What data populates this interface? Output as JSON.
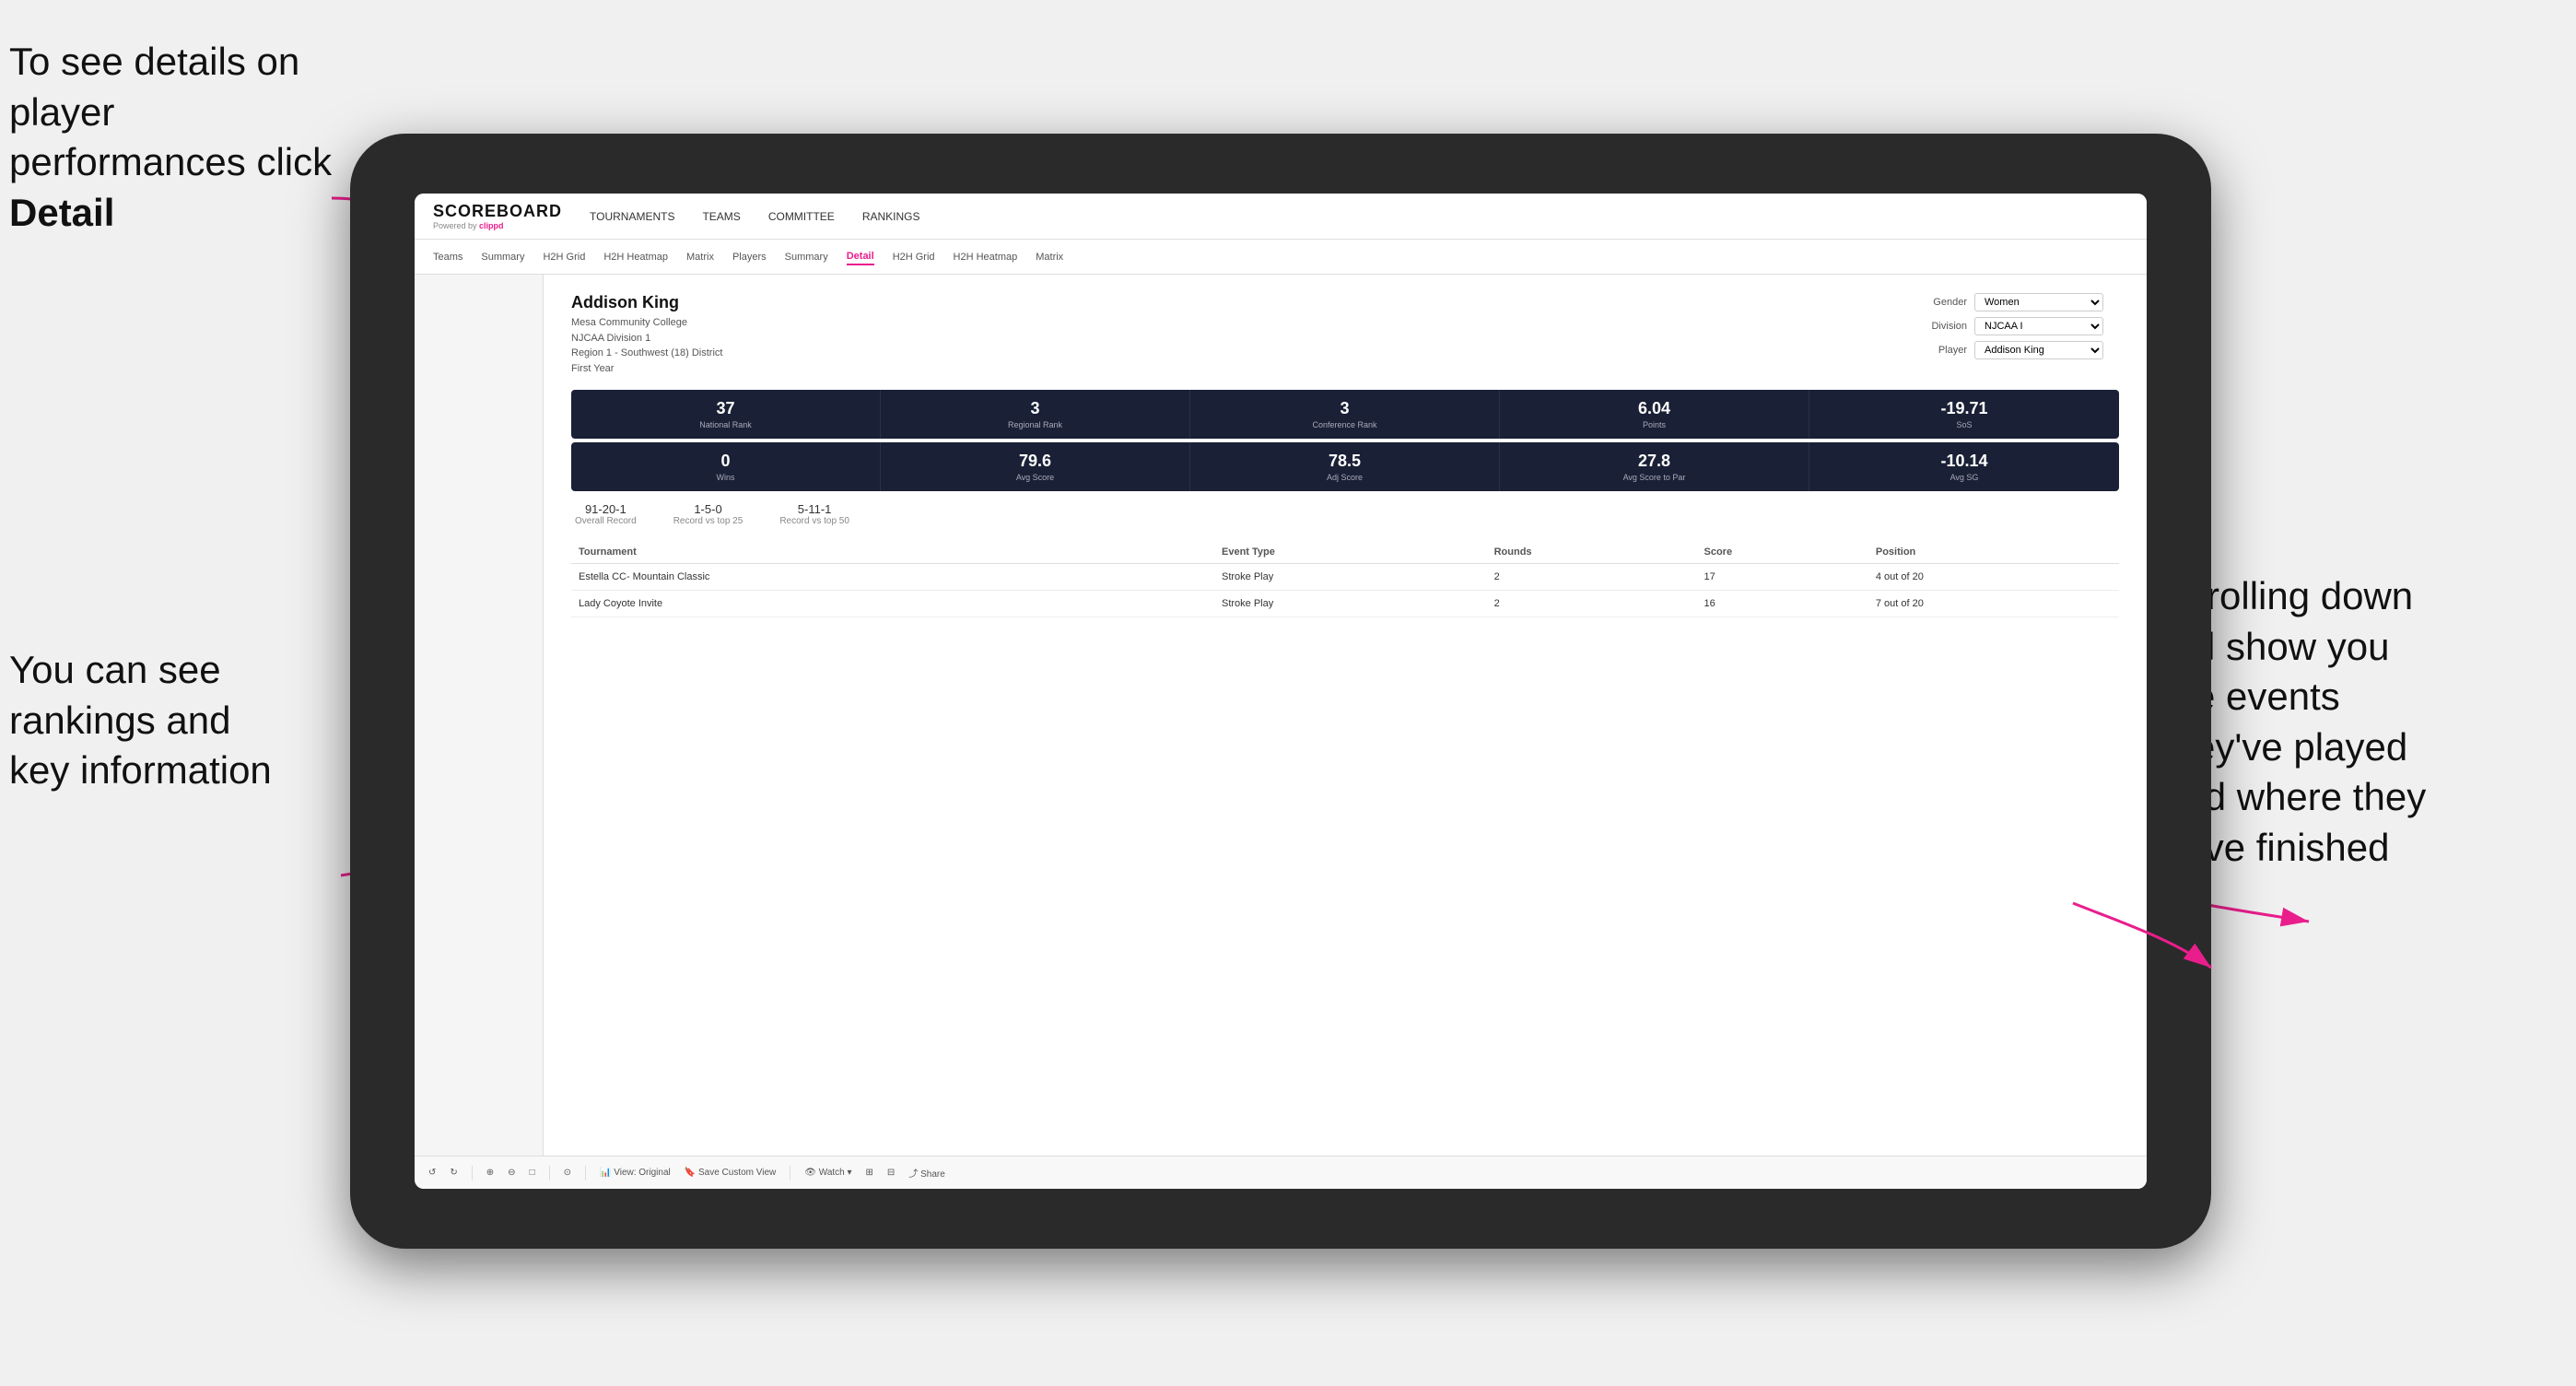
{
  "annotations": {
    "top_left": "To see details on player performances click ",
    "top_left_bold": "Detail",
    "bottom_left_line1": "You can see",
    "bottom_left_line2": "rankings and",
    "bottom_left_line3": "key information",
    "right_line1": "Scrolling down",
    "right_line2": "will show you",
    "right_line3": "the events",
    "right_line4": "they've played",
    "right_line5": "and where they",
    "right_line6": "have finished"
  },
  "nav": {
    "logo": "SCOREBOARD",
    "powered_by": "Powered by ",
    "clippd": "clippd",
    "items": [
      {
        "label": "TOURNAMENTS",
        "active": false
      },
      {
        "label": "TEAMS",
        "active": false
      },
      {
        "label": "COMMITTEE",
        "active": false
      },
      {
        "label": "RANKINGS",
        "active": false
      }
    ]
  },
  "subnav": {
    "items": [
      {
        "label": "Teams",
        "active": false
      },
      {
        "label": "Summary",
        "active": false
      },
      {
        "label": "H2H Grid",
        "active": false
      },
      {
        "label": "H2H Heatmap",
        "active": false
      },
      {
        "label": "Matrix",
        "active": false
      },
      {
        "label": "Players",
        "active": false
      },
      {
        "label": "Summary",
        "active": false
      },
      {
        "label": "Detail",
        "active": true
      },
      {
        "label": "H2H Grid",
        "active": false
      },
      {
        "label": "H2H Heatmap",
        "active": false
      },
      {
        "label": "Matrix",
        "active": false
      }
    ]
  },
  "player": {
    "name": "Addison King",
    "college": "Mesa Community College",
    "division": "NJCAA Division 1",
    "region": "Region 1 - Southwest (18) District",
    "year": "First Year"
  },
  "filters": {
    "gender_label": "Gender",
    "gender_value": "Women",
    "division_label": "Division",
    "division_value": "NJCAA I",
    "player_label": "Player",
    "player_value": "Addison King"
  },
  "stats_row1": [
    {
      "value": "37",
      "label": "National Rank"
    },
    {
      "value": "3",
      "label": "Regional Rank"
    },
    {
      "value": "3",
      "label": "Conference Rank"
    },
    {
      "value": "6.04",
      "label": "Points"
    },
    {
      "value": "-19.71",
      "label": "SoS"
    }
  ],
  "stats_row2": [
    {
      "value": "0",
      "label": "Wins"
    },
    {
      "value": "79.6",
      "label": "Avg Score"
    },
    {
      "value": "78.5",
      "label": "Adj Score"
    },
    {
      "value": "27.8",
      "label": "Avg Score to Par"
    },
    {
      "value": "-10.14",
      "label": "Avg SG"
    }
  ],
  "records": [
    {
      "value": "91-20-1",
      "label": "Overall Record"
    },
    {
      "value": "1-5-0",
      "label": "Record vs top 25"
    },
    {
      "value": "5-11-1",
      "label": "Record vs top 50"
    }
  ],
  "table": {
    "headers": [
      "Tournament",
      "",
      "Event Type",
      "Rounds",
      "Score",
      "Position"
    ],
    "rows": [
      {
        "tournament": "Estella CC- Mountain Classic",
        "event_type": "Stroke Play",
        "rounds": "2",
        "score": "17",
        "position": "4 out of 20"
      },
      {
        "tournament": "Lady Coyote Invite",
        "event_type": "Stroke Play",
        "rounds": "2",
        "score": "16",
        "position": "7 out of 20"
      }
    ]
  },
  "toolbar": {
    "buttons": [
      {
        "label": "↺"
      },
      {
        "label": "↻"
      },
      {
        "label": "⊕"
      },
      {
        "label": "⊖"
      },
      {
        "label": "□"
      },
      {
        "label": "⊙"
      },
      {
        "label": "View: Original"
      },
      {
        "label": "Save Custom View"
      },
      {
        "label": "Watch ▾"
      },
      {
        "label": "⊞"
      },
      {
        "label": "⊟"
      },
      {
        "label": "Share"
      }
    ]
  }
}
